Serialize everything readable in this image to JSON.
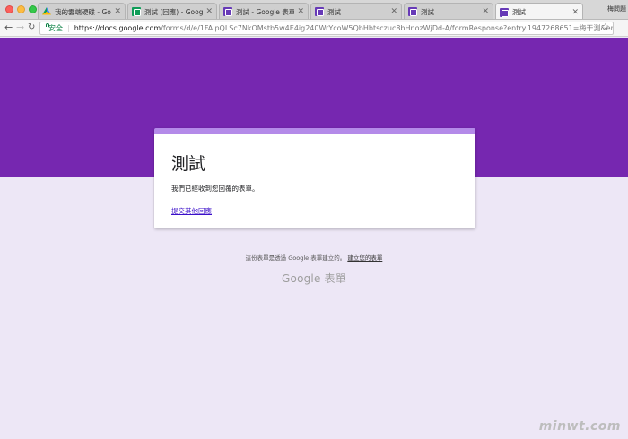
{
  "browser": {
    "tabs": [
      {
        "label": "我的雲端硬碟 - Google",
        "favicon": "drive-icon"
      },
      {
        "label": "測試 (回應) - Google 試",
        "favicon": "sheets-icon"
      },
      {
        "label": "測試 - Google 表單",
        "favicon": "forms-icon"
      },
      {
        "label": "測試",
        "favicon": "forms-icon"
      },
      {
        "label": "測試",
        "favicon": "forms-icon"
      },
      {
        "label": "測試",
        "favicon": "forms-icon"
      }
    ],
    "active_tab": 5,
    "profile": "梅問題",
    "secure_label": "安全",
    "url_host": "https://docs.google.com",
    "url_path": "/forms/d/e/1FAlpQLSc7NkOMstb5w4E4ig240WrYcoW5QbHbtsczuc8bHnozWjDd-A/formResponse?entry.1947268651=梅干測&entry...."
  },
  "form": {
    "title": "測試",
    "confirmation": "我們已經收到您回覆的表單。",
    "submit_another": "提交其他回應"
  },
  "footer": {
    "note": "這份表單是透過 Google 表單建立的。",
    "create_link": "建立您的表單",
    "logo": "Google 表單"
  },
  "watermark": "minwt.com",
  "colors": {
    "banner": "#7627b0",
    "card_accent": "#b48ae9",
    "background": "#ede7f6",
    "link": "#3b0fc9"
  }
}
